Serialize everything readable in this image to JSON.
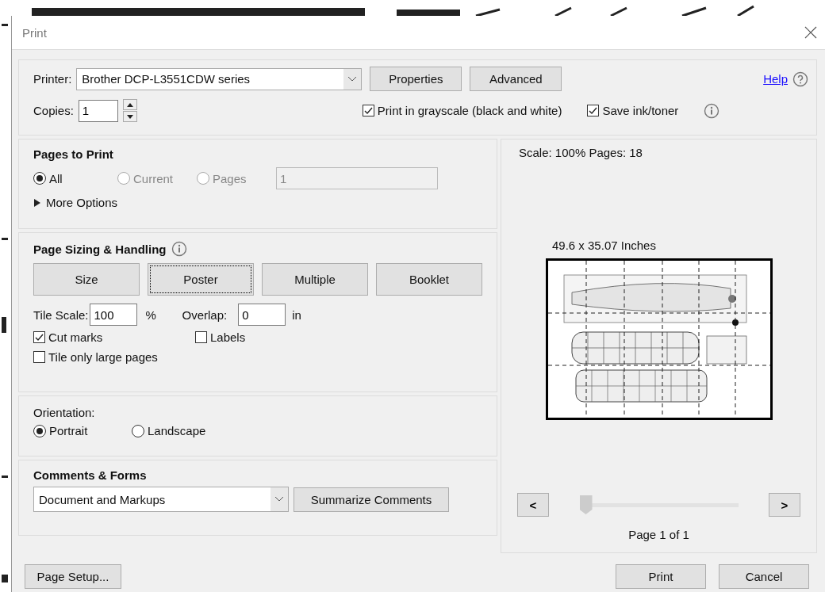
{
  "window": {
    "title": "Print"
  },
  "printer": {
    "label": "Printer:",
    "value": "Brother DCP-L3551CDW series"
  },
  "printer_buttons": [
    "Properties",
    "Advanced"
  ],
  "help": {
    "label": "Help"
  },
  "copies": {
    "label": "Copies:",
    "value": "1"
  },
  "options": [
    {
      "label": "Print in grayscale (black and white)",
      "checked": true
    },
    {
      "label": "Save ink/toner",
      "checked": true
    }
  ],
  "pages_to_print": {
    "title": "Pages to Print",
    "choices": [
      {
        "label": "All",
        "selected": true,
        "disabled": false
      },
      {
        "label": "Current",
        "selected": false,
        "disabled": true
      },
      {
        "label": "Pages",
        "selected": false,
        "disabled": true
      }
    ],
    "pages_field": {
      "value": "1",
      "disabled": true
    },
    "more_options": {
      "label": "More Options",
      "expanded": false
    }
  },
  "page_sizing": {
    "title": "Page Sizing & Handling",
    "modes": [
      {
        "label": "Size",
        "selected": false
      },
      {
        "label": "Poster",
        "selected": true
      },
      {
        "label": "Multiple",
        "selected": false
      },
      {
        "label": "Booklet",
        "selected": false
      }
    ],
    "tile_scale": {
      "label": "Tile Scale:",
      "value": "100",
      "unit": "%"
    },
    "overlap": {
      "label": "Overlap:",
      "value": "0",
      "unit": "in"
    },
    "checks": [
      {
        "label": "Cut marks",
        "checked": true
      },
      {
        "label": "Labels",
        "checked": false
      },
      {
        "label": "Tile only large pages",
        "checked": false
      }
    ]
  },
  "orientation": {
    "title": "Orientation:",
    "choices": [
      {
        "label": "Portrait",
        "selected": true
      },
      {
        "label": "Landscape",
        "selected": false
      }
    ]
  },
  "comments_forms": {
    "title": "Comments & Forms",
    "value": "Document and Markups",
    "button": "Summarize Comments"
  },
  "preview": {
    "scale_info": "Scale: 100% Pages: 18",
    "size": "49.6 x 35.07 Inches",
    "prev": "<",
    "next": ">",
    "slider": {
      "level": 0
    },
    "page_label": "Page 1 of 1"
  },
  "footer": {
    "page_setup": "Page Setup...",
    "buttons": [
      "Print",
      "Cancel"
    ]
  }
}
